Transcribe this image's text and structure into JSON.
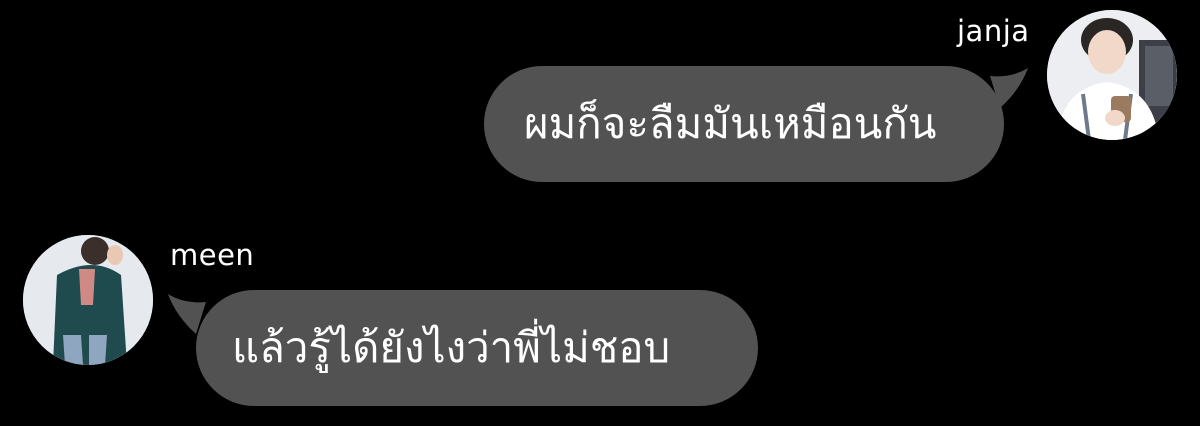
{
  "messages": [
    {
      "sender": "janja",
      "side": "right",
      "text": "ผมก็จะลืมมันเหมือนกัน",
      "avatar_icon": "profile-photo-icon"
    },
    {
      "sender": "meen",
      "side": "left",
      "text": "แล้วรู้ได้ยังไงว่าพี่ไม่ชอบ",
      "avatar_icon": "profile-photo-icon"
    }
  ],
  "colors": {
    "background": "#000000",
    "bubble": "#525252",
    "text": "#ffffff"
  }
}
